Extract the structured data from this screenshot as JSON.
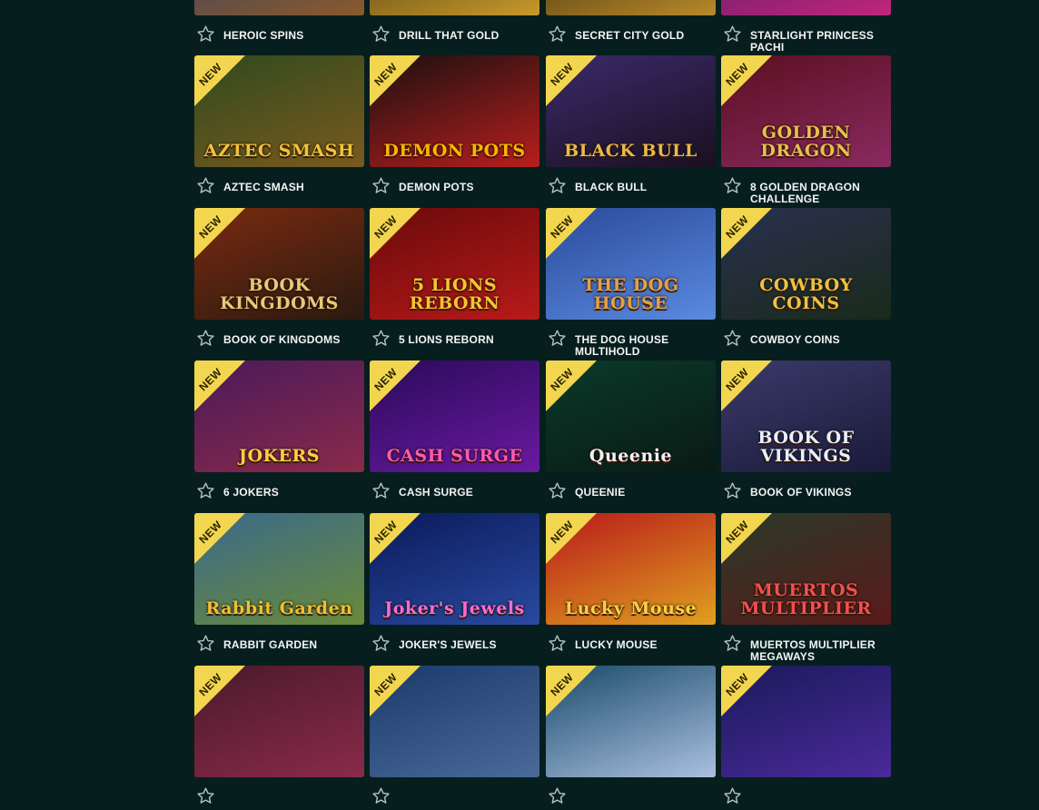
{
  "badge_label": "NEW",
  "colors": {
    "background": "#061f1e",
    "badge": "#f3d64f",
    "title_text": "#f4f4f4",
    "star_outline": "#b9c3c2"
  },
  "games": [
    {
      "name": "HEROIC SPINS",
      "new": false,
      "art": [
        "#2a3d6b",
        "#8b5a2b"
      ]
    },
    {
      "name": "DRILL THAT GOLD",
      "new": false,
      "art": [
        "#3a2a12",
        "#c89a2a"
      ]
    },
    {
      "name": "SECRET CITY GOLD",
      "new": false,
      "art": [
        "#2a1a08",
        "#b88a2a"
      ]
    },
    {
      "name": "STARLIGHT PRINCESS PACHI",
      "new": false,
      "art": [
        "#4a1a6a",
        "#c0267a"
      ]
    },
    {
      "name": "AZTEC SMASH",
      "new": true,
      "logo": "AZTEC SMASH",
      "logo_color": "#f2c23a",
      "art": [
        "#2f4a1e",
        "#7a5a1e"
      ]
    },
    {
      "name": "DEMON POTS",
      "new": true,
      "logo": "DEMON POTS",
      "logo_color": "#ffb400",
      "art": [
        "#1a1010",
        "#b81e1e"
      ]
    },
    {
      "name": "BLACK BULL",
      "new": true,
      "logo": "BLACK BULL",
      "logo_color": "#e8b84a",
      "art": [
        "#3a2a6a",
        "#1a1020"
      ]
    },
    {
      "name": "8 GOLDEN DRAGON CHALLENGE",
      "new": true,
      "logo": "GOLDEN DRAGON",
      "logo_color": "#e8c04a",
      "art": [
        "#5a1020",
        "#8a2a60"
      ]
    },
    {
      "name": "BOOK OF KINGDOMS",
      "new": true,
      "logo": "BOOK KINGDOMS",
      "logo_color": "#e8c87a",
      "art": [
        "#7a2a10",
        "#2a1a10"
      ]
    },
    {
      "name": "5 LIONS REBORN",
      "new": true,
      "logo": "5 LIONS REBORN",
      "logo_color": "#f4c430",
      "art": [
        "#6a0a0a",
        "#b81a1a"
      ]
    },
    {
      "name": "THE DOG HOUSE MULTIHOLD",
      "new": true,
      "logo": "THE DOG HOUSE",
      "logo_color": "#e8a040",
      "art": [
        "#2a4a9a",
        "#5a8ae0"
      ]
    },
    {
      "name": "COWBOY COINS",
      "new": true,
      "logo": "COWBOY COINS",
      "logo_color": "#f0c040",
      "art": [
        "#2a3050",
        "#1a2a1a"
      ]
    },
    {
      "name": "6 JOKERS",
      "new": true,
      "logo": "JOKERS",
      "logo_color": "#ffd040",
      "art": [
        "#4a1a5a",
        "#8a2a4a"
      ]
    },
    {
      "name": "CASH SURGE",
      "new": true,
      "logo": "CASH SURGE",
      "logo_color": "#ff5ab0",
      "art": [
        "#2a0a5a",
        "#6a1aa0"
      ]
    },
    {
      "name": "QUEENIE",
      "new": true,
      "logo": "Queenie",
      "logo_color": "#f6eef6",
      "art": [
        "#0a3a2a",
        "#0a1a14"
      ]
    },
    {
      "name": "BOOK OF VIKINGS",
      "new": true,
      "logo": "BOOK OF VIKINGS",
      "logo_color": "#e8f0ff",
      "art": [
        "#3a3a6a",
        "#1a1a3a"
      ]
    },
    {
      "name": "RABBIT GARDEN",
      "new": true,
      "logo": "Rabbit Garden",
      "logo_color": "#f0c030",
      "art": [
        "#3a6a8a",
        "#6a8a3a"
      ]
    },
    {
      "name": "JOKER'S JEWELS",
      "new": true,
      "logo": "Joker's Jewels",
      "logo_color": "#ff6ad0",
      "art": [
        "#0a1a5a",
        "#2a4aa0"
      ]
    },
    {
      "name": "LUCKY MOUSE",
      "new": true,
      "logo": "Lucky Mouse",
      "logo_color": "#ffd040",
      "art": [
        "#b81a1a",
        "#e0a020"
      ]
    },
    {
      "name": "MUERTOS MULTIPLIER MEGAWAYS",
      "new": true,
      "logo": "MUERTOS MULTIPLIER",
      "logo_color": "#f05050",
      "art": [
        "#2a3a2a",
        "#5a1a1a"
      ]
    },
    {
      "name": "",
      "new": true,
      "art": [
        "#4a1a2a",
        "#8a2a4a"
      ]
    },
    {
      "name": "",
      "new": true,
      "art": [
        "#1a3a6a",
        "#4a6a9a"
      ]
    },
    {
      "name": "",
      "new": true,
      "art": [
        "#1a4a6a",
        "#aac0e0"
      ]
    },
    {
      "name": "",
      "new": true,
      "art": [
        "#1a1a5a",
        "#4a2a9a"
      ]
    }
  ]
}
